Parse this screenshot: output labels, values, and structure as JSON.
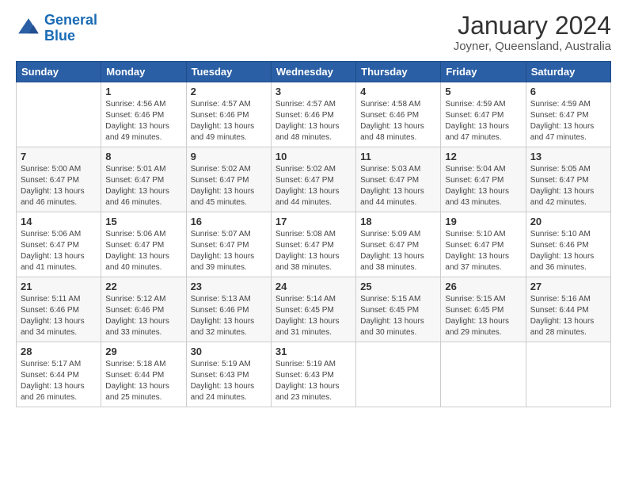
{
  "logo": {
    "line1": "General",
    "line2": "Blue"
  },
  "header": {
    "month": "January 2024",
    "location": "Joyner, Queensland, Australia"
  },
  "weekdays": [
    "Sunday",
    "Monday",
    "Tuesday",
    "Wednesday",
    "Thursday",
    "Friday",
    "Saturday"
  ],
  "weeks": [
    [
      {
        "day": "",
        "info": ""
      },
      {
        "day": "1",
        "info": "Sunrise: 4:56 AM\nSunset: 6:46 PM\nDaylight: 13 hours\nand 49 minutes."
      },
      {
        "day": "2",
        "info": "Sunrise: 4:57 AM\nSunset: 6:46 PM\nDaylight: 13 hours\nand 49 minutes."
      },
      {
        "day": "3",
        "info": "Sunrise: 4:57 AM\nSunset: 6:46 PM\nDaylight: 13 hours\nand 48 minutes."
      },
      {
        "day": "4",
        "info": "Sunrise: 4:58 AM\nSunset: 6:46 PM\nDaylight: 13 hours\nand 48 minutes."
      },
      {
        "day": "5",
        "info": "Sunrise: 4:59 AM\nSunset: 6:47 PM\nDaylight: 13 hours\nand 47 minutes."
      },
      {
        "day": "6",
        "info": "Sunrise: 4:59 AM\nSunset: 6:47 PM\nDaylight: 13 hours\nand 47 minutes."
      }
    ],
    [
      {
        "day": "7",
        "info": "Sunrise: 5:00 AM\nSunset: 6:47 PM\nDaylight: 13 hours\nand 46 minutes."
      },
      {
        "day": "8",
        "info": "Sunrise: 5:01 AM\nSunset: 6:47 PM\nDaylight: 13 hours\nand 46 minutes."
      },
      {
        "day": "9",
        "info": "Sunrise: 5:02 AM\nSunset: 6:47 PM\nDaylight: 13 hours\nand 45 minutes."
      },
      {
        "day": "10",
        "info": "Sunrise: 5:02 AM\nSunset: 6:47 PM\nDaylight: 13 hours\nand 44 minutes."
      },
      {
        "day": "11",
        "info": "Sunrise: 5:03 AM\nSunset: 6:47 PM\nDaylight: 13 hours\nand 44 minutes."
      },
      {
        "day": "12",
        "info": "Sunrise: 5:04 AM\nSunset: 6:47 PM\nDaylight: 13 hours\nand 43 minutes."
      },
      {
        "day": "13",
        "info": "Sunrise: 5:05 AM\nSunset: 6:47 PM\nDaylight: 13 hours\nand 42 minutes."
      }
    ],
    [
      {
        "day": "14",
        "info": "Sunrise: 5:06 AM\nSunset: 6:47 PM\nDaylight: 13 hours\nand 41 minutes."
      },
      {
        "day": "15",
        "info": "Sunrise: 5:06 AM\nSunset: 6:47 PM\nDaylight: 13 hours\nand 40 minutes."
      },
      {
        "day": "16",
        "info": "Sunrise: 5:07 AM\nSunset: 6:47 PM\nDaylight: 13 hours\nand 39 minutes."
      },
      {
        "day": "17",
        "info": "Sunrise: 5:08 AM\nSunset: 6:47 PM\nDaylight: 13 hours\nand 38 minutes."
      },
      {
        "day": "18",
        "info": "Sunrise: 5:09 AM\nSunset: 6:47 PM\nDaylight: 13 hours\nand 38 minutes."
      },
      {
        "day": "19",
        "info": "Sunrise: 5:10 AM\nSunset: 6:47 PM\nDaylight: 13 hours\nand 37 minutes."
      },
      {
        "day": "20",
        "info": "Sunrise: 5:10 AM\nSunset: 6:46 PM\nDaylight: 13 hours\nand 36 minutes."
      }
    ],
    [
      {
        "day": "21",
        "info": "Sunrise: 5:11 AM\nSunset: 6:46 PM\nDaylight: 13 hours\nand 34 minutes."
      },
      {
        "day": "22",
        "info": "Sunrise: 5:12 AM\nSunset: 6:46 PM\nDaylight: 13 hours\nand 33 minutes."
      },
      {
        "day": "23",
        "info": "Sunrise: 5:13 AM\nSunset: 6:46 PM\nDaylight: 13 hours\nand 32 minutes."
      },
      {
        "day": "24",
        "info": "Sunrise: 5:14 AM\nSunset: 6:45 PM\nDaylight: 13 hours\nand 31 minutes."
      },
      {
        "day": "25",
        "info": "Sunrise: 5:15 AM\nSunset: 6:45 PM\nDaylight: 13 hours\nand 30 minutes."
      },
      {
        "day": "26",
        "info": "Sunrise: 5:15 AM\nSunset: 6:45 PM\nDaylight: 13 hours\nand 29 minutes."
      },
      {
        "day": "27",
        "info": "Sunrise: 5:16 AM\nSunset: 6:44 PM\nDaylight: 13 hours\nand 28 minutes."
      }
    ],
    [
      {
        "day": "28",
        "info": "Sunrise: 5:17 AM\nSunset: 6:44 PM\nDaylight: 13 hours\nand 26 minutes."
      },
      {
        "day": "29",
        "info": "Sunrise: 5:18 AM\nSunset: 6:44 PM\nDaylight: 13 hours\nand 25 minutes."
      },
      {
        "day": "30",
        "info": "Sunrise: 5:19 AM\nSunset: 6:43 PM\nDaylight: 13 hours\nand 24 minutes."
      },
      {
        "day": "31",
        "info": "Sunrise: 5:19 AM\nSunset: 6:43 PM\nDaylight: 13 hours\nand 23 minutes."
      },
      {
        "day": "",
        "info": ""
      },
      {
        "day": "",
        "info": ""
      },
      {
        "day": "",
        "info": ""
      }
    ]
  ]
}
